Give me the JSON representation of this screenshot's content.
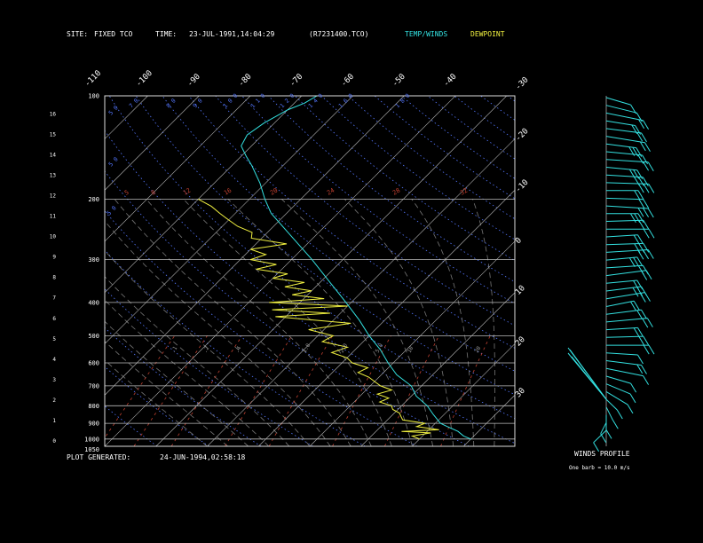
{
  "header": {
    "site_label": "SITE:",
    "site_value": "FIXED TCO",
    "time_label": "TIME:",
    "time_value": "23-JUL-1991,14:04:29",
    "file": "(R7231400.TCO)",
    "legend_temp": "TEMP/WINDS",
    "legend_dew": "DEWPOINT"
  },
  "footer": {
    "generated_label": "PLOT GENERATED:",
    "generated_value": "24-JUN-1994,02:58:18",
    "profile_title": "WINDS PROFILE",
    "barb_note": "One barb = 10.0 m/s"
  },
  "colors": {
    "temp": "#33e0e0",
    "dewpoint": "#f0f040",
    "isotherm": "#bbbbbb",
    "isobar": "#bbbbbb",
    "dry_adiabat": "#5577ff",
    "moist_adiabat": "#777777",
    "mixing_ratio": "#c04030",
    "frame": "#dddddd",
    "text": "#ffffff"
  },
  "chart_data": {
    "type": "line",
    "pressure_labels": [
      "100",
      "200",
      "300",
      "400",
      "500",
      "600",
      "700",
      "800",
      "900",
      "1000",
      "1050"
    ],
    "height_km_labels": [
      "16",
      "15",
      "14",
      "13",
      "12",
      "11",
      "10",
      "9",
      "8",
      "7",
      "6",
      "5",
      "4",
      "3",
      "2",
      "1",
      "0"
    ],
    "isotherm_top_labels": [
      "-110",
      "-100",
      "-90",
      "-80",
      "-70",
      "-60",
      "-50",
      "-40"
    ],
    "isotherm_right_labels": [
      "-30",
      "-20",
      "-10",
      "0",
      "10",
      "20",
      "30"
    ],
    "mixing_ratio_labels": [
      ".1",
      ".2",
      ".4",
      "1.0",
      "2.0",
      "5.0",
      "10",
      "20"
    ],
    "mixing_ratio_top_labels": [
      "5",
      "8",
      "12",
      "16",
      "20",
      "24",
      "28",
      "32"
    ],
    "theta_labels": [
      "5 0",
      "5 0",
      "5 0",
      "7 0",
      "8 0",
      "9 0",
      "1 0 0",
      "1 1 0",
      "1 2 0",
      "1 4 0",
      "1 6 0",
      "1 8 0"
    ],
    "ylim_pressure_hpa": [
      1050,
      100
    ],
    "xlim_temp_c_at_1050": [
      -40,
      40
    ],
    "temperature": {
      "pressure": [
        1000,
        980,
        950,
        920,
        900,
        850,
        800,
        750,
        700,
        650,
        600,
        550,
        500,
        450,
        400,
        350,
        300,
        250,
        220,
        200,
        180,
        160,
        150,
        140,
        130,
        120,
        110,
        105,
        100
      ],
      "temp_c": [
        30,
        28,
        26,
        23,
        21,
        18,
        15,
        11,
        8,
        3,
        -1,
        -5,
        -10,
        -15,
        -21,
        -28,
        -36,
        -46,
        -53,
        -57,
        -61,
        -66,
        -69,
        -72,
        -73,
        -72,
        -70,
        -68,
        -67
      ]
    },
    "dewpoint": {
      "pressure": [
        1000,
        980,
        960,
        950,
        940,
        920,
        900,
        880,
        860,
        840,
        820,
        800,
        780,
        760,
        740,
        720,
        700,
        680,
        660,
        640,
        620,
        600,
        580,
        560,
        540,
        520,
        500,
        480,
        460,
        440,
        430,
        420,
        410,
        400,
        390,
        380,
        370,
        360,
        350,
        340,
        330,
        320,
        310,
        300,
        290,
        280,
        270,
        260,
        250,
        240,
        230,
        220,
        210,
        200
      ],
      "dew_c": [
        20,
        18,
        21,
        15,
        22,
        17,
        18,
        13,
        12,
        11,
        9,
        8,
        5,
        6,
        3,
        5,
        2,
        0,
        -2,
        -5,
        -4,
        -8,
        -10,
        -14,
        -12,
        -18,
        -17,
        -23,
        -16,
        -32,
        -22,
        -34,
        -20,
        -36,
        -26,
        -33,
        -30,
        -36,
        -33,
        -40,
        -38,
        -45,
        -42,
        -48,
        -46,
        -50,
        -44,
        -52,
        -53,
        -57,
        -60,
        -63,
        -66,
        -70
      ]
    }
  },
  "wind_profile": {
    "barbs": [
      {
        "dir": 230,
        "speed": 10
      },
      {
        "dir": 235,
        "speed": 12
      },
      {
        "dir": 240,
        "speed": 15
      },
      {
        "dir": 245,
        "speed": 18
      },
      {
        "dir": 250,
        "speed": 20
      },
      {
        "dir": 245,
        "speed": 22
      },
      {
        "dir": 250,
        "speed": 25
      },
      {
        "dir": 255,
        "speed": 20
      },
      {
        "dir": 260,
        "speed": 24
      },
      {
        "dir": 255,
        "speed": 28
      },
      {
        "dir": 260,
        "speed": 30
      },
      {
        "dir": 265,
        "speed": 26
      },
      {
        "dir": 270,
        "speed": 22
      },
      {
        "dir": 265,
        "speed": 20
      },
      {
        "dir": 260,
        "speed": 25
      },
      {
        "dir": 270,
        "speed": 28
      },
      {
        "dir": 275,
        "speed": 24
      },
      {
        "dir": 270,
        "speed": 22
      },
      {
        "dir": 280,
        "speed": 20
      },
      {
        "dir": 275,
        "speed": 26
      },
      {
        "dir": 280,
        "speed": 30
      },
      {
        "dir": 285,
        "speed": 28
      },
      {
        "dir": 280,
        "speed": 24
      },
      {
        "dir": 290,
        "speed": 22
      },
      {
        "dir": 285,
        "speed": 20
      },
      {
        "dir": 290,
        "speed": 25
      },
      {
        "dir": 295,
        "speed": 22
      },
      {
        "dir": 300,
        "speed": 18
      },
      {
        "dir": 290,
        "speed": 20
      },
      {
        "dir": 285,
        "speed": 22
      },
      {
        "dir": 280,
        "speed": 20
      },
      {
        "dir": 275,
        "speed": 18
      },
      {
        "dir": 270,
        "speed": 16
      },
      {
        "dir": 260,
        "speed": 14
      },
      {
        "dir": 250,
        "speed": 16
      },
      {
        "dir": 240,
        "speed": 14
      },
      {
        "dir": 230,
        "speed": 12
      },
      {
        "dir": 220,
        "speed": 12
      },
      {
        "dir": 210,
        "speed": 10
      },
      {
        "dir": 200,
        "speed": 10
      },
      {
        "dir": 190,
        "speed": 12
      },
      {
        "dir": 180,
        "speed": 10
      },
      {
        "dir": 170,
        "speed": 12
      },
      {
        "dir": 160,
        "speed": 10
      }
    ]
  }
}
